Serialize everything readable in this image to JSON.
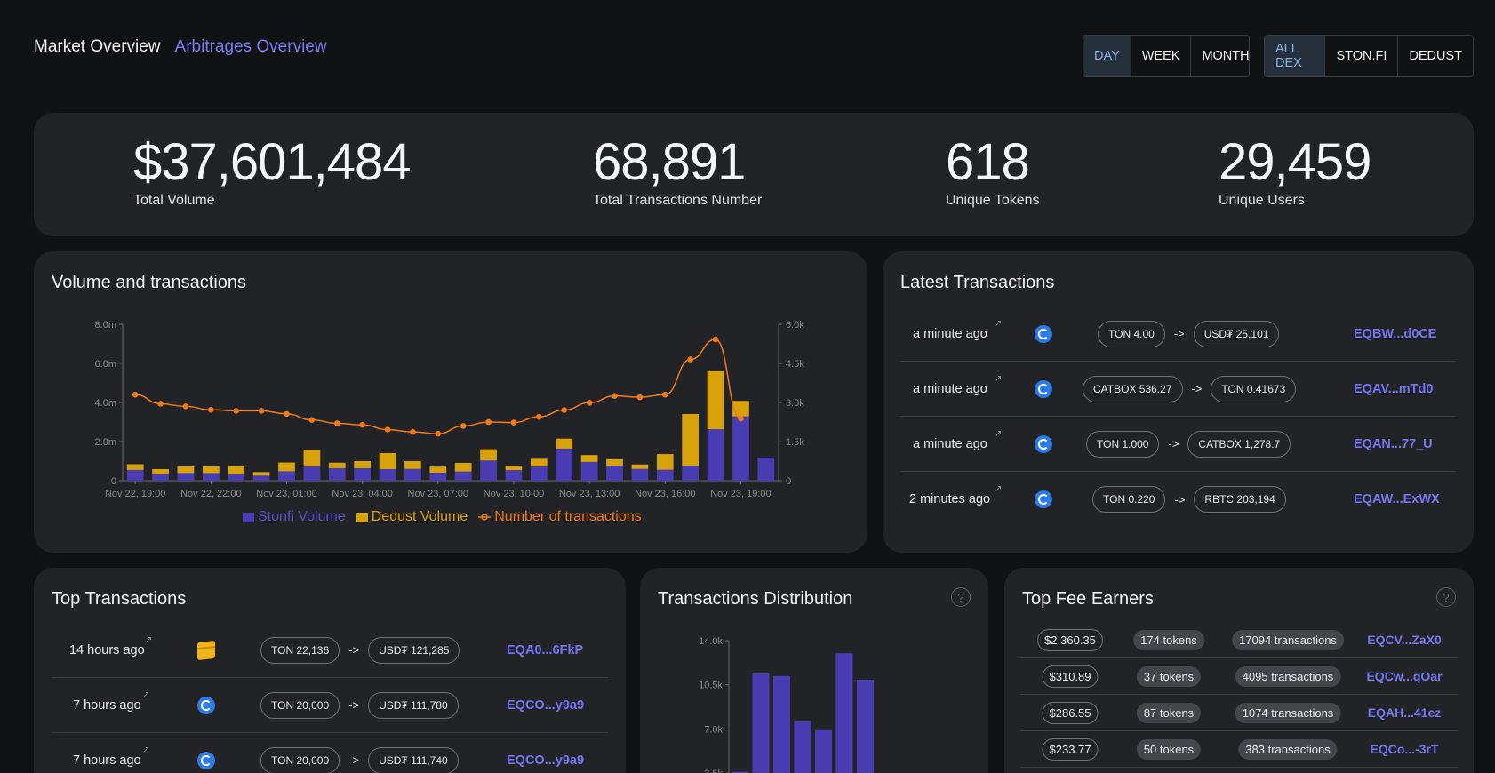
{
  "nav": {
    "market": "Market Overview",
    "arbitrages": "Arbitrages Overview"
  },
  "period": {
    "day": "DAY",
    "week": "WEEK",
    "month": "MONTH",
    "selected": "DAY"
  },
  "dex": {
    "all": "ALL DEX",
    "ston": "STON.FI",
    "dedust": "DEDUST",
    "selected": "ALL DEX"
  },
  "stats": {
    "volume": {
      "value": "$37,601,484",
      "label": "Total Volume"
    },
    "transactions": {
      "value": "68,891",
      "label": "Total Transactions Number"
    },
    "tokens": {
      "value": "618",
      "label": "Unique Tokens"
    },
    "users": {
      "value": "29,459",
      "label": "Unique Users"
    }
  },
  "volume_card": {
    "title": "Volume and transactions"
  },
  "chart_data": [
    {
      "type": "bar",
      "title": "Volume and transactions",
      "stacked": true,
      "x_tick_labels": [
        "Nov 22, 19:00",
        "Nov 22, 22:00",
        "Nov 23, 01:00",
        "Nov 23, 04:00",
        "Nov 23, 07:00",
        "Nov 23, 10:00",
        "Nov 23, 13:00",
        "Nov 23, 16:00",
        "Nov 23, 19:00"
      ],
      "y_left_ticks": [
        "0",
        "2.0m",
        "4.0m",
        "6.0m",
        "8.0m"
      ],
      "y_left_lim": [
        0,
        8000000
      ],
      "y_right_ticks": [
        "0",
        "1.5k",
        "3.0k",
        "4.5k",
        "6.0k"
      ],
      "y_right_lim": [
        0,
        6000
      ],
      "legend_position": "bottom",
      "colors": {
        "stonfi": "#4a3db4",
        "dedust": "#d8a20c",
        "tx": "#f07a1a"
      },
      "series": [
        {
          "name": "Stonfi Volume",
          "axis": "left",
          "values": [
            550000,
            330000,
            390000,
            390000,
            330000,
            260000,
            480000,
            730000,
            640000,
            640000,
            590000,
            600000,
            410000,
            470000,
            1030000,
            540000,
            740000,
            1640000,
            960000,
            760000,
            600000,
            560000,
            760000,
            2630000,
            3290000,
            1180000
          ]
        },
        {
          "name": "Dedust Volume",
          "axis": "left",
          "values": [
            290000,
            260000,
            340000,
            340000,
            410000,
            180000,
            450000,
            850000,
            280000,
            360000,
            820000,
            400000,
            310000,
            440000,
            580000,
            220000,
            380000,
            510000,
            350000,
            340000,
            230000,
            800000,
            2650000,
            2980000,
            790000
          ]
        },
        {
          "name": "Number of transactions",
          "axis": "right",
          "type": "line",
          "values": [
            3300,
            2950,
            2850,
            2720,
            2680,
            2680,
            2560,
            2330,
            2200,
            2140,
            1960,
            1870,
            1800,
            2100,
            2250,
            2230,
            2450,
            2710,
            2990,
            3250,
            3200,
            3300,
            4650,
            5420,
            2380
          ]
        }
      ]
    },
    {
      "type": "bar",
      "title": "Transactions Distribution",
      "y_ticks": [
        "3.5k",
        "7.0k",
        "10.5k",
        "14.0k"
      ],
      "ylim": [
        0,
        14000
      ],
      "series": [
        {
          "name": "",
          "values": [
            3600,
            11400,
            11200,
            7600,
            6900,
            13000,
            10900
          ]
        }
      ]
    }
  ],
  "latest": {
    "title": "Latest Transactions",
    "rows": [
      {
        "time": "a minute ago",
        "from": "TON 4.00",
        "to": "USD₮ 25.101",
        "address": "EQBW...d0CE"
      },
      {
        "time": "a minute ago",
        "from": "CATBOX 536.27",
        "to": "TON 0.41673",
        "address": "EQAV...mTd0"
      },
      {
        "time": "a minute ago",
        "from": "TON 1.000",
        "to": "CATBOX 1,278.7",
        "address": "EQAN...77_U"
      },
      {
        "time": "2 minutes ago",
        "from": "TON 0.220",
        "to": "RBTC 203,194",
        "address": "EQAW...ExWX"
      }
    ]
  },
  "top_tx": {
    "title": "Top Transactions",
    "rows": [
      {
        "time": "14 hours ago",
        "dex": "dedust",
        "from": "TON 22,136",
        "to": "USD₮ 121,285",
        "address": "EQA0...6FkP"
      },
      {
        "time": "7 hours ago",
        "dex": "stonfi",
        "from": "TON 20,000",
        "to": "USD₮ 111,780",
        "address": "EQCO...y9a9"
      },
      {
        "time": "7 hours ago",
        "dex": "stonfi",
        "from": "TON 20,000",
        "to": "USD₮ 111,740",
        "address": "EQCO...y9a9"
      }
    ]
  },
  "dist": {
    "title": "Transactions Distribution",
    "help": "?"
  },
  "fees": {
    "title": "Top Fee Earners",
    "help": "?",
    "rows": [
      {
        "amount": "$2,360.35",
        "tokens": "174 tokens",
        "tx": "17094 transactions",
        "address": "EQCV...ZaX0"
      },
      {
        "amount": "$310.89",
        "tokens": "37 tokens",
        "tx": "4095 transactions",
        "address": "EQCw...qOar"
      },
      {
        "amount": "$286.55",
        "tokens": "87 tokens",
        "tx": "1074 transactions",
        "address": "EQAH...41ez"
      },
      {
        "amount": "$233.77",
        "tokens": "50 tokens",
        "tx": "383 transactions",
        "address": "EQCo...-3rT"
      }
    ]
  },
  "arrow": "->"
}
